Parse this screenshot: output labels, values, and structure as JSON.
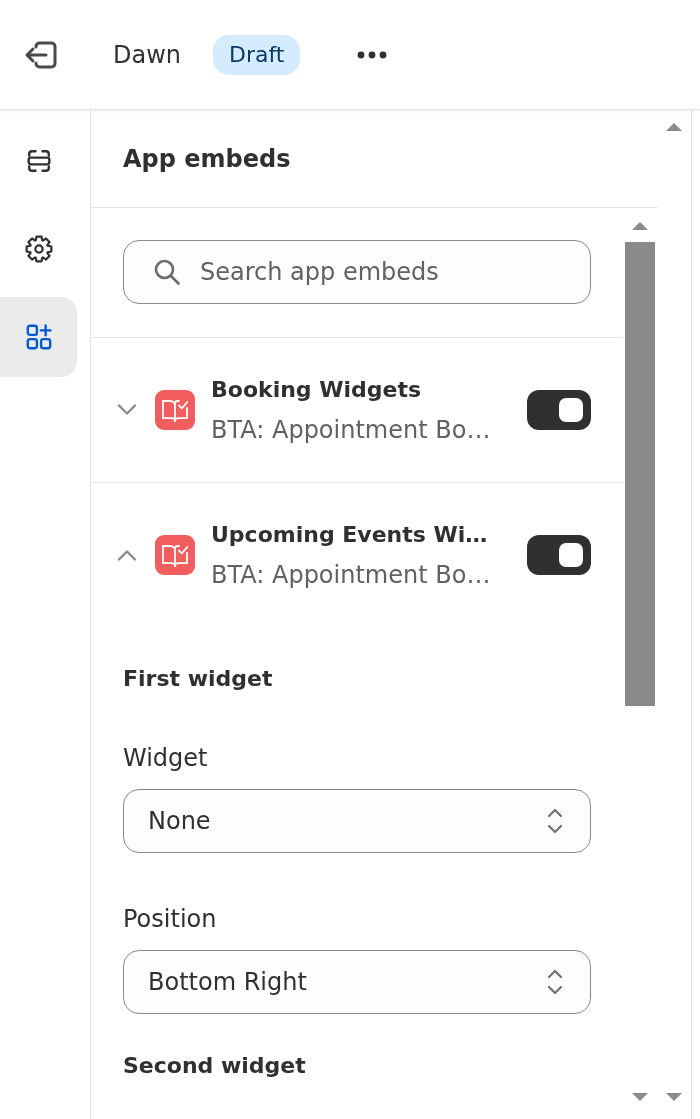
{
  "top_bar": {
    "theme_name": "Dawn",
    "status_badge": "Draft"
  },
  "sidebar": {
    "items": [
      {
        "selected": false
      },
      {
        "selected": false
      },
      {
        "selected": true
      }
    ]
  },
  "panel": {
    "title": "App embeds",
    "search": {
      "placeholder": "Search app embeds"
    },
    "embeds": [
      {
        "title": "Booking Widgets",
        "subtitle": "BTA: Appointment Bo…",
        "expanded": false,
        "on": true
      },
      {
        "title": "Upcoming Events Wi…",
        "subtitle": "BTA: Appointment Bo…",
        "expanded": true,
        "on": true,
        "settings": [
          {
            "kind": "heading",
            "text": "First widget"
          },
          {
            "kind": "select",
            "label": "Widget",
            "value": "None"
          },
          {
            "kind": "select",
            "label": "Position",
            "value": "Bottom Right"
          },
          {
            "kind": "heading",
            "text": "Second widget"
          }
        ]
      }
    ]
  }
}
